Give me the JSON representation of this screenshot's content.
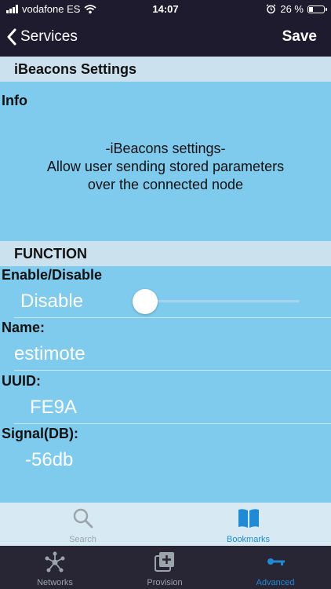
{
  "status": {
    "carrier": "vodafone ES",
    "time": "14:07",
    "battery": "26 %"
  },
  "nav": {
    "back_label": "Services",
    "save_label": "Save"
  },
  "sections": {
    "ibeacons_header": "iBeacons Settings",
    "info_label": "Info",
    "info_lines": [
      "-iBeacons settings-",
      "Allow user sending stored parameters",
      "over the connected node"
    ],
    "function_header": "FUNCTION"
  },
  "fields": {
    "enable_label": "Enable/Disable",
    "enable_value": "Disable",
    "enable_on": false,
    "name_label": "Name:",
    "name_value": "estimote",
    "uuid_label": "UUID:",
    "uuid_value": "FE9A",
    "signal_label": "Signal(DB):",
    "signal_value": "-56db"
  },
  "tabs_top": [
    {
      "label": "Search",
      "icon": "search-icon",
      "active": false
    },
    {
      "label": "Bookmarks",
      "icon": "bookmarks-icon",
      "active": true
    }
  ],
  "tabs_bottom": [
    {
      "label": "Networks",
      "icon": "network-icon",
      "active": false
    },
    {
      "label": "Provision",
      "icon": "add-box-icon",
      "active": false
    },
    {
      "label": "Advanced",
      "icon": "key-icon",
      "active": true
    }
  ],
  "colors": {
    "nav_bg": "#1f1b2f",
    "content_bg": "#7fcbee",
    "header_bg": "#cce1ee",
    "accent": "#1f8ad6",
    "inactive": "#9ba4ab"
  }
}
